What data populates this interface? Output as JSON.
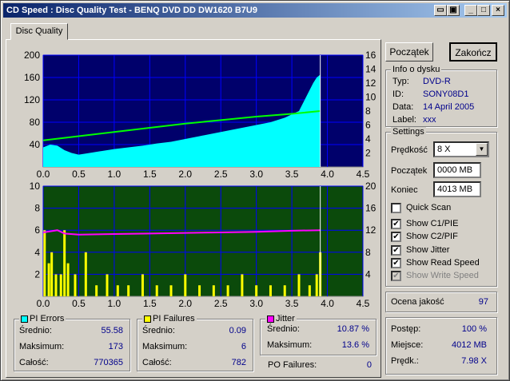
{
  "window": {
    "title": "CD Speed : Disc Quality Test - BENQ    DVD DD DW1620    B7U9"
  },
  "tab": {
    "label": "Disc Quality"
  },
  "buttons": {
    "start": "Początek",
    "end": "Zakończ"
  },
  "info": {
    "title": "Info o dysku",
    "type_label": "Typ:",
    "type_value": "DVD-R",
    "id_label": "ID:",
    "id_value": "SONY08D1",
    "date_label": "Data:",
    "date_value": "14 April 2005",
    "label_label": "Label:",
    "label_value": "xxx"
  },
  "settings": {
    "title": "Settings",
    "speed_label": "Prędkość",
    "speed_value": "8 X",
    "start_label": "Początek",
    "start_value": "0000 MB",
    "end_label": "Koniec",
    "end_value": "4013 MB",
    "quick_scan": "Quick Scan",
    "show_c1": "Show C1/PIE",
    "show_c2": "Show C2/PIF",
    "show_jitter": "Show Jitter",
    "show_read": "Show Read Speed",
    "show_write": "Show Write Speed"
  },
  "quality": {
    "label": "Ocena jakość",
    "value": "97"
  },
  "progress": {
    "progress_label": "Postęp:",
    "progress_value": "100 %",
    "place_label": "Miejsce:",
    "place_value": "4012 MB",
    "speed_label": "Prędk.:",
    "speed_value": "7.98 X"
  },
  "pi_errors": {
    "title": "PI Errors",
    "color": "#00ffff",
    "avg_label": "Średnio:",
    "avg_value": "55.58",
    "max_label": "Maksimum:",
    "max_value": "173",
    "total_label": "Całość:",
    "total_value": "770365"
  },
  "pi_failures": {
    "title": "PI Failures",
    "color": "#ffff00",
    "avg_label": "Średnio:",
    "avg_value": "0.09",
    "max_label": "Maksimum:",
    "max_value": "6",
    "total_label": "Całość:",
    "total_value": "782"
  },
  "jitter": {
    "title": "Jitter",
    "color": "#ff00ff",
    "avg_label": "Średnio:",
    "avg_value": "10.87 %",
    "max_label": "Maksimum:",
    "max_value": "13.6 %"
  },
  "po_failures": {
    "label": "PO Failures:",
    "value": "0"
  },
  "chart_data": [
    {
      "type": "area",
      "xlim": [
        0,
        4.5
      ],
      "ylim": [
        0,
        200
      ],
      "y2lim": [
        0,
        16
      ],
      "x_ticks": [
        "0.0",
        "0.5",
        "1.0",
        "1.5",
        "2.0",
        "2.5",
        "3.0",
        "3.5",
        "4.0",
        "4.5"
      ],
      "y_ticks": [
        "200",
        "160",
        "120",
        "80",
        "40"
      ],
      "y2_ticks": [
        "16",
        "14",
        "12",
        "10",
        "8",
        "6",
        "4",
        "2"
      ],
      "series": [
        {
          "color": "#00ffff",
          "x": [
            0,
            0.1,
            0.2,
            0.3,
            0.4,
            0.5,
            0.6,
            0.8,
            1.0,
            1.2,
            1.4,
            1.6,
            1.8,
            2.0,
            2.2,
            2.4,
            2.6,
            2.8,
            3.0,
            3.2,
            3.4,
            3.6,
            3.7,
            3.8,
            3.85,
            3.9
          ],
          "y": [
            35,
            40,
            38,
            30,
            25,
            22,
            24,
            28,
            32,
            35,
            38,
            42,
            45,
            50,
            55,
            60,
            65,
            70,
            75,
            80,
            88,
            100,
            125,
            150,
            160,
            165
          ]
        },
        {
          "color": "#00ff00",
          "axis": "right",
          "x": [
            0,
            0.5,
            1.0,
            1.5,
            2.0,
            2.5,
            3.0,
            3.5,
            3.9
          ],
          "y": [
            3.8,
            4.4,
            5.0,
            5.6,
            6.2,
            6.7,
            7.2,
            7.6,
            8.0
          ]
        }
      ]
    },
    {
      "type": "bar",
      "xlim": [
        0,
        4.5
      ],
      "ylim": [
        0,
        10
      ],
      "y2lim": [
        0,
        20
      ],
      "x_ticks": [
        "0.0",
        "0.5",
        "1.0",
        "1.5",
        "2.0",
        "2.5",
        "3.0",
        "3.5",
        "4.0",
        "4.5"
      ],
      "y_ticks": [
        "10",
        "8",
        "6",
        "4",
        "2"
      ],
      "y2_ticks": [
        "20",
        "16",
        "12",
        "8",
        "4"
      ],
      "series": [
        {
          "color": "#ffff00",
          "x": [
            0.02,
            0.08,
            0.12,
            0.18,
            0.25,
            0.3,
            0.35,
            0.45,
            0.6,
            0.75,
            0.9,
            1.05,
            1.2,
            1.4,
            1.6,
            1.8,
            2.0,
            2.2,
            2.4,
            2.6,
            2.8,
            3.0,
            3.2,
            3.4,
            3.6,
            3.75,
            3.85,
            3.9
          ],
          "y": [
            6,
            3,
            4,
            2,
            2,
            6,
            3,
            2,
            4,
            1,
            2,
            1,
            1,
            2,
            1,
            1,
            2,
            1,
            1,
            1,
            2,
            1,
            1,
            1,
            2,
            1,
            2,
            4
          ]
        },
        {
          "color": "#ff00ff",
          "axis": "right",
          "x": [
            0,
            0.1,
            0.2,
            0.3,
            0.5,
            1.0,
            1.5,
            2.0,
            2.5,
            3.0,
            3.5,
            3.9
          ],
          "y": [
            11.6,
            11.8,
            12.0,
            11.4,
            11.2,
            11.3,
            11.4,
            11.5,
            11.6,
            11.7,
            11.9,
            12.0
          ]
        }
      ]
    }
  ]
}
